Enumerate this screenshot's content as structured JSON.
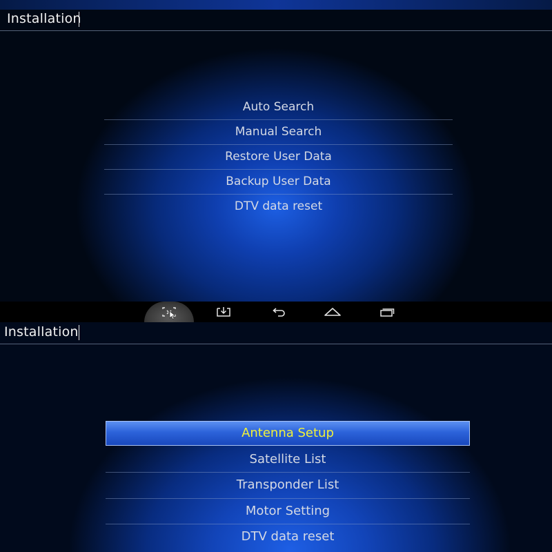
{
  "screens": [
    {
      "title": "Installation",
      "menu": [
        "Auto Search",
        "Manual Search",
        "Restore User Data",
        "Backup User Data",
        "DTV data reset"
      ]
    },
    {
      "title": "Installation",
      "selected_index": 0,
      "menu": [
        "Antenna Setup",
        "Satellite List",
        "Transponder List",
        "Motor Setting",
        "DTV data reset"
      ]
    }
  ],
  "navbar": {
    "buttons": [
      "screenshot-icon",
      "download-icon",
      "back-icon",
      "home-icon",
      "recent-apps-icon"
    ],
    "active": "screenshot-icon"
  },
  "colors": {
    "selected_text": "#f1f23a",
    "menu_text": "#d4d9e4",
    "selected_bg": "#2c63da"
  }
}
